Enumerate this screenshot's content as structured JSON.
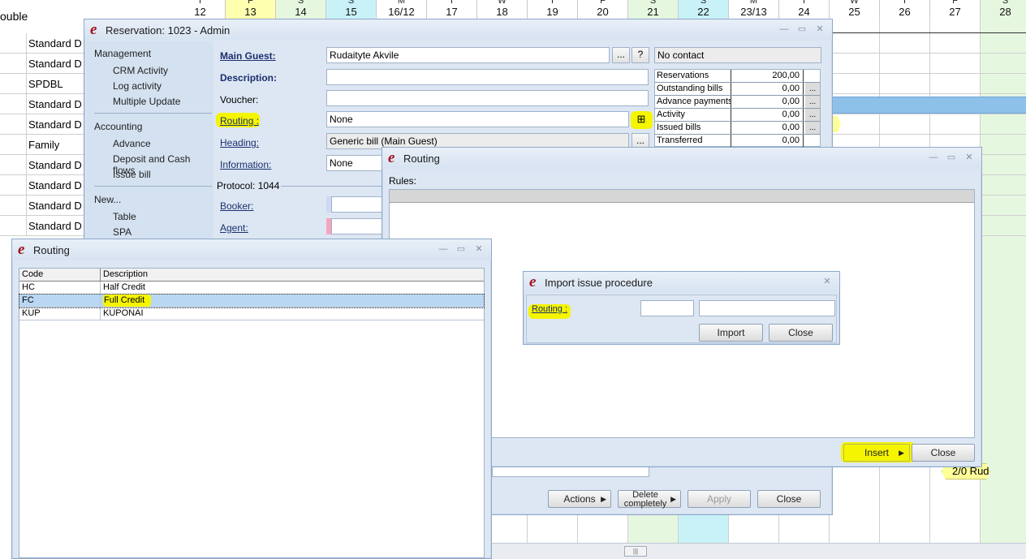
{
  "calendar": {
    "first_col_label": "ouble",
    "days": [
      {
        "w": "T",
        "n": "12",
        "bg": "#ffffff"
      },
      {
        "w": "F",
        "n": "13",
        "bg": "#ffffb0"
      },
      {
        "w": "S",
        "n": "14",
        "bg": "#e6f7e0"
      },
      {
        "w": "S",
        "n": "15",
        "bg": "#c9f2f8"
      },
      {
        "w": "M",
        "n": "16/12",
        "bg": "#ffffff"
      },
      {
        "w": "T",
        "n": "17",
        "bg": "#ffffff"
      },
      {
        "w": "W",
        "n": "18",
        "bg": "#ffffff"
      },
      {
        "w": "T",
        "n": "19",
        "bg": "#ffffff"
      },
      {
        "w": "F",
        "n": "20",
        "bg": "#ffffff"
      },
      {
        "w": "S",
        "n": "21",
        "bg": "#e6f7e0"
      },
      {
        "w": "S",
        "n": "22",
        "bg": "#c9f2f8"
      },
      {
        "w": "M",
        "n": "23/13",
        "bg": "#ffffff"
      },
      {
        "w": "T",
        "n": "24",
        "bg": "#ffffff"
      },
      {
        "w": "W",
        "n": "25",
        "bg": "#ffffff"
      },
      {
        "w": "T",
        "n": "26",
        "bg": "#ffffff"
      },
      {
        "w": "F",
        "n": "27",
        "bg": "#ffffff"
      },
      {
        "w": "S",
        "n": "28",
        "bg": "#e6f7e0"
      }
    ],
    "rooms": [
      "Standard D",
      "Standard D",
      "SPDBL",
      "Standard D",
      "Standard D",
      "Family",
      "Standard D",
      "Standard D",
      "Standard D",
      "Standard D"
    ],
    "booking_label": "2/0 Rud",
    "colors": {
      "weekend_green": "#e6f7e0",
      "weekend_cyan": "#c9f2f8",
      "friday": "#ffffb0",
      "booking_blue": "#8ec1ea",
      "booking_tag": "#ffff99"
    }
  },
  "reservation": {
    "title": "Reservation: 1023 - Admin",
    "menu": {
      "management": "Management",
      "management_items": [
        "CRM Activity",
        "Log activity",
        "Multiple Update"
      ],
      "accounting": "Accounting",
      "accounting_items": [
        "Advance",
        "Deposit and Cash flows",
        "Issue bill"
      ],
      "new": "New...",
      "new_items": [
        "Table",
        "SPA"
      ]
    },
    "main_guest_label": "Main Guest:",
    "main_guest_value": "Rudaityte Akvile",
    "more_btn": "...",
    "help_btn": "?",
    "contact_value": "No contact",
    "description_label": "Description:",
    "voucher_label": "Voucher:",
    "routing_label": "Routing :",
    "routing_value": "None",
    "heading_label": "Heading:",
    "heading_value": "Generic bill (Main Guest)",
    "information_label": "Information:",
    "information_value": "None",
    "protocol": "Protocol: 1044",
    "booker_label": "Booker:",
    "agent_label": "Agent:",
    "summary": [
      {
        "label": "Reservations",
        "value": "200,00"
      },
      {
        "label": "Outstanding bills",
        "value": "0,00"
      },
      {
        "label": "Advance payments",
        "value": "0,00"
      },
      {
        "label": "Activity",
        "value": "0,00"
      },
      {
        "label": "Issued bills",
        "value": "0,00"
      },
      {
        "label": "Transferred",
        "value": "0,00"
      }
    ],
    "buttons": {
      "actions": "Actions",
      "delete": "Delete completely",
      "apply": "Apply",
      "close": "Close"
    }
  },
  "routing_rules": {
    "title": "Routing",
    "rules_label": "Rules:",
    "insert_btn": "Insert",
    "close_btn": "Close"
  },
  "routing_list": {
    "title": "Routing",
    "columns": [
      "Code",
      "Description"
    ],
    "rows": [
      {
        "code": "HC",
        "description": "Half Credit"
      },
      {
        "code": "FC",
        "description": "Full Credit"
      },
      {
        "code": "KUP",
        "description": "KUPONAI"
      }
    ]
  },
  "import_dialog": {
    "title": "Import issue procedure",
    "routing_label": "Routing :",
    "import_btn": "Import",
    "close_btn": "Close"
  }
}
